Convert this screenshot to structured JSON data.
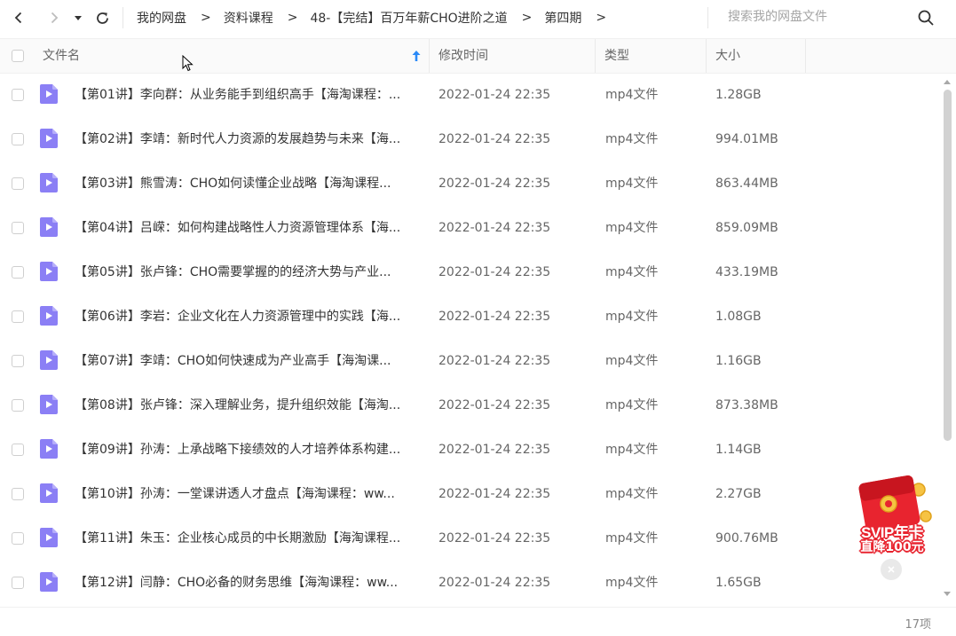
{
  "nav": {
    "back_icon": "chevron-left-icon",
    "forward_icon": "chevron-right-icon",
    "dropdown_icon": "caret-down-icon",
    "refresh_icon": "refresh-icon"
  },
  "breadcrumb": {
    "items": [
      "我的网盘",
      "资料课程",
      "48-【完结】百万年薪CHO进阶之道",
      "第四期"
    ],
    "separator": ">"
  },
  "search": {
    "placeholder": "搜索我的网盘文件",
    "value": ""
  },
  "table": {
    "columns": [
      "文件名",
      "修改时间",
      "类型",
      "大小"
    ],
    "sort": {
      "column": "文件名",
      "direction": "ascending"
    },
    "rows": [
      {
        "name": "【第01讲】李向群：从业务能手到组织高手【海淘课程：...",
        "date": "2022-01-24 22:35",
        "type": "mp4文件",
        "size": "1.28GB"
      },
      {
        "name": "【第02讲】李靖：新时代人力资源的发展趋势与未来【海...",
        "date": "2022-01-24 22:35",
        "type": "mp4文件",
        "size": "994.01MB"
      },
      {
        "name": "【第03讲】熊雪涛：CHO如何读懂企业战略【海淘课程...",
        "date": "2022-01-24 22:35",
        "type": "mp4文件",
        "size": "863.44MB"
      },
      {
        "name": "【第04讲】吕嵘：如何构建战略性人力资源管理体系【海...",
        "date": "2022-01-24 22:35",
        "type": "mp4文件",
        "size": "859.09MB"
      },
      {
        "name": "【第05讲】张卢锋：CHO需要掌握的的经济大势与产业...",
        "date": "2022-01-24 22:35",
        "type": "mp4文件",
        "size": "433.19MB"
      },
      {
        "name": "【第06讲】李岩：企业文化在人力资源管理中的实践【海...",
        "date": "2022-01-24 22:35",
        "type": "mp4文件",
        "size": "1.08GB"
      },
      {
        "name": "【第07讲】李靖：CHO如何快速成为产业高手【海淘课...",
        "date": "2022-01-24 22:35",
        "type": "mp4文件",
        "size": "1.16GB"
      },
      {
        "name": "【第08讲】张卢锋：深入理解业务，提升组织效能【海淘...",
        "date": "2022-01-24 22:35",
        "type": "mp4文件",
        "size": "873.38MB"
      },
      {
        "name": "【第09讲】孙涛：上承战略下接绩效的人才培养体系构建...",
        "date": "2022-01-24 22:35",
        "type": "mp4文件",
        "size": "1.14GB"
      },
      {
        "name": "【第10讲】孙涛：一堂课讲透人才盘点【海淘课程：ww...",
        "date": "2022-01-24 22:35",
        "type": "mp4文件",
        "size": "2.27GB"
      },
      {
        "name": "【第11讲】朱玉：企业核心成员的中长期激励【海淘课程...",
        "date": "2022-01-24 22:35",
        "type": "mp4文件",
        "size": "900.76MB"
      },
      {
        "name": "【第12讲】闫静：CHO必备的财务思维【海淘课程：ww...",
        "date": "2022-01-24 22:35",
        "type": "mp4文件",
        "size": "1.65GB"
      }
    ]
  },
  "footer": {
    "count": "17项"
  },
  "promo": {
    "line1": "SVIP年卡",
    "line2": "直降100元"
  },
  "colors": {
    "file_icon": "#8b7ff5",
    "sort_arrow": "#2b8af7",
    "promo_red": "#e8242f"
  }
}
